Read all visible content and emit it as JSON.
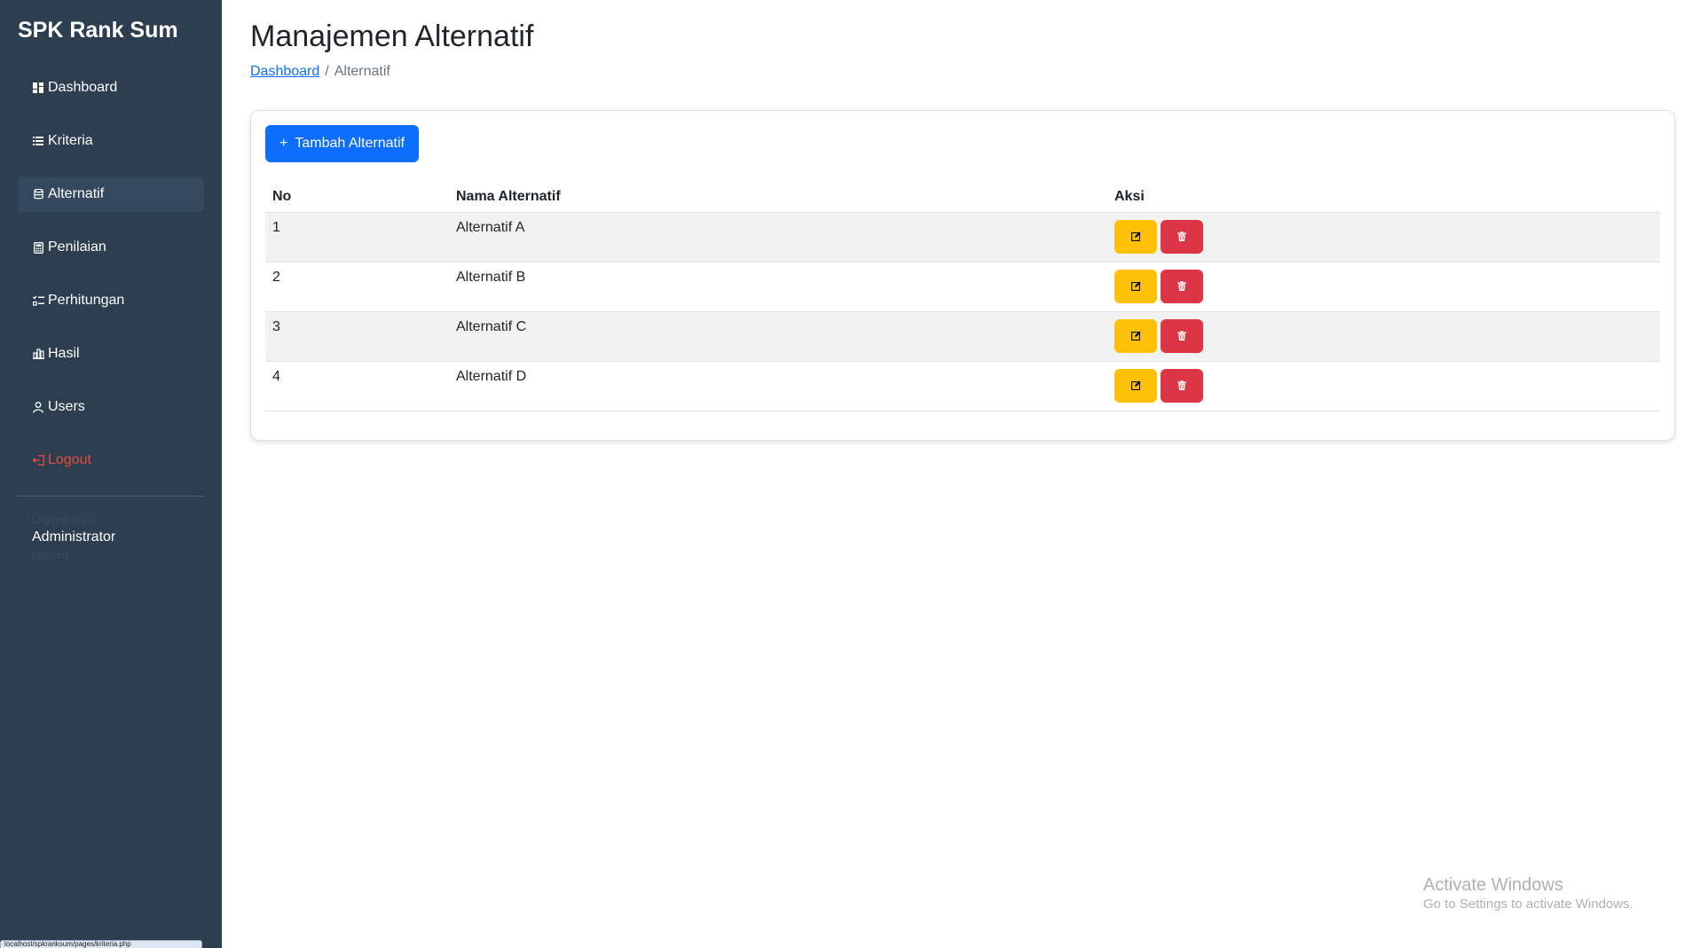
{
  "sidebar": {
    "brand": "SPK Rank Sum",
    "items": [
      {
        "label": "Dashboard",
        "icon": "grid-icon"
      },
      {
        "label": "Kriteria",
        "icon": "list-icon"
      },
      {
        "label": "Alternatif",
        "icon": "database-icon"
      },
      {
        "label": "Penilaian",
        "icon": "calculator-icon"
      },
      {
        "label": "Perhitungan",
        "icon": "list-check-icon"
      },
      {
        "label": "Hasil",
        "icon": "bar-chart-icon"
      },
      {
        "label": "Users",
        "icon": "person-icon"
      },
      {
        "label": "Logout",
        "icon": "logout-icon"
      }
    ],
    "active_item": "Alternatif",
    "user": {
      "logged_in_label": "Logged in as:",
      "name": "Administrator",
      "username": "(admin)"
    },
    "status_url": "localhost/spkranksum/pages/kriteria.php"
  },
  "main": {
    "title": "Manajemen Alternatif",
    "breadcrumb": {
      "link": "Dashboard",
      "separator": "/",
      "current": "Alternatif"
    },
    "add_button": "Tambah Alternatif",
    "table": {
      "headers": [
        "No",
        "Nama Alternatif",
        "Aksi"
      ],
      "rows": [
        {
          "no": "1",
          "nama": "Alternatif A"
        },
        {
          "no": "2",
          "nama": "Alternatif B"
        },
        {
          "no": "3",
          "nama": "Alternatif C"
        },
        {
          "no": "4",
          "nama": "Alternatif D"
        }
      ]
    }
  },
  "watermark": {
    "title": "Activate Windows",
    "subtitle": "Go to Settings to activate Windows."
  },
  "colors": {
    "sidebar_bg": "#2c3e50",
    "sidebar_active": "#34495e",
    "primary": "#0d6efd",
    "warning": "#ffc107",
    "danger": "#dc3545",
    "logout": "#e74c3c"
  }
}
